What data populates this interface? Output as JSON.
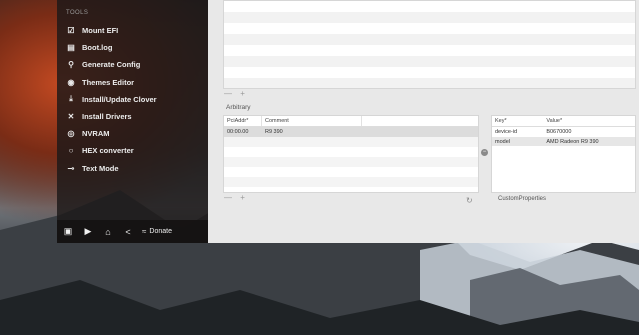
{
  "sidebar": {
    "section_header": "TOOLS",
    "items": [
      {
        "label": "Mount EFI",
        "icon": "disk-icon",
        "glyph": "☑"
      },
      {
        "label": "Boot.log",
        "icon": "log-icon",
        "glyph": "▤"
      },
      {
        "label": "Generate Config",
        "icon": "magnifier-icon",
        "glyph": "⚲"
      },
      {
        "label": "Themes Editor",
        "icon": "eye-icon",
        "glyph": "◉"
      },
      {
        "label": "Install/Update Clover",
        "icon": "download-icon",
        "glyph": "⤓"
      },
      {
        "label": "Install Drivers",
        "icon": "tools-icon",
        "glyph": "✕"
      },
      {
        "label": "NVRAM",
        "icon": "chip-icon",
        "glyph": "◎"
      },
      {
        "label": "HEX converter",
        "icon": "circle-icon",
        "glyph": "○"
      },
      {
        "label": "Text Mode",
        "icon": "toggle-icon",
        "glyph": "⊸"
      }
    ],
    "footer": {
      "donate_label": "Donate"
    }
  },
  "top_table": {
    "add_remove": "— +"
  },
  "arbitrary": {
    "section_label": "Arbitrary",
    "columns": [
      "PciAddr*",
      "Comment"
    ],
    "rows": [
      {
        "pciaddr": "00:00.00",
        "comment": "R9 390"
      }
    ],
    "add_remove": "— +"
  },
  "properties": {
    "columns": [
      "Key*",
      "Value*"
    ],
    "rows": [
      {
        "key": "device-id",
        "value": "B0670000"
      },
      {
        "key": "model",
        "value": "AMD Radeon R9 390"
      }
    ],
    "footer_label": "CustomProperties"
  }
}
